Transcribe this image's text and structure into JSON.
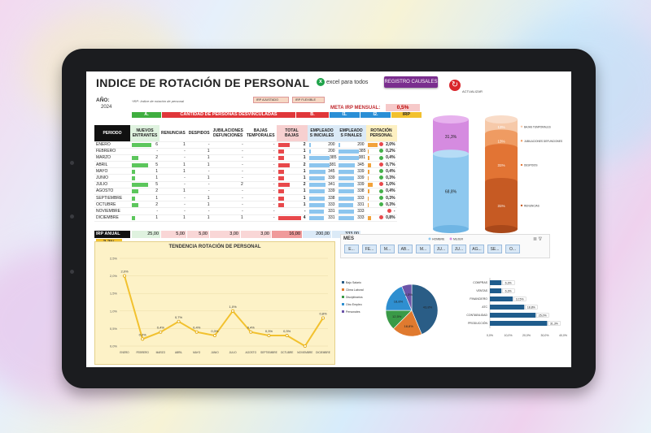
{
  "title": "INDICE DE ROTACIÓN DE PERSONAL",
  "logo": "excel para todos",
  "register_button": "REGISTRO CAUSALES",
  "update_label": "ACTUALIZAR",
  "year_label": "AÑO:",
  "year": "2024",
  "irp_note": "*IRP: Indice de rotación de personal",
  "option_adjusted": "IRP AJUSTADO",
  "option_flexible": "IRP FLEXIBLE",
  "meta_label": "META IRP MENSUAL:",
  "meta_value": "0,5%",
  "group_a": "A.",
  "group_desv": "CANTIDAD DE PERSONAS DESVINCULADAS",
  "group_b": "B.",
  "group_i1": "I1.",
  "group_i2": "I2.",
  "group_irp": "IRP",
  "columns": [
    "PERIODO",
    "NUEVOS ENTRANTES",
    "RENUNCIAS",
    "DESPIDOS",
    "JUBILACIONES DEFUNCIONES",
    "BAJAS TEMPORALES",
    "TOTAL BAJAS",
    "EMPLEADO S INICIALES",
    "EMPLEADO S FINALES",
    "ROTACIÓN PERSONAL"
  ],
  "rows": [
    {
      "m": "ENERO",
      "n": "6",
      "r": "1",
      "d": "-",
      "j": "-",
      "b": "-",
      "t": "2",
      "i": "200",
      "f": "200",
      "p": "2,0%"
    },
    {
      "m": "FEBRERO",
      "n": "-",
      "r": "-",
      "d": "1",
      "j": "-",
      "b": "-",
      "t": "1",
      "i": "200",
      "f": "385",
      "p": "0,2%"
    },
    {
      "m": "MARZO",
      "n": "2",
      "r": "-",
      "d": "1",
      "j": "-",
      "b": "-",
      "t": "1",
      "i": "385",
      "f": "381",
      "p": "0,4%"
    },
    {
      "m": "ABRIL",
      "n": "5",
      "r": "1",
      "d": "1",
      "j": "-",
      "b": "-",
      "t": "2",
      "i": "381",
      "f": "345",
      "p": "0,7%"
    },
    {
      "m": "MAYO",
      "n": "1",
      "r": "1",
      "d": "-",
      "j": "-",
      "b": "-",
      "t": "1",
      "i": "345",
      "f": "339",
      "p": "0,4%"
    },
    {
      "m": "JUNIO",
      "n": "1",
      "r": "-",
      "d": "1",
      "j": "-",
      "b": "-",
      "t": "1",
      "i": "339",
      "f": "339",
      "p": "0,3%"
    },
    {
      "m": "JULIO",
      "n": "5",
      "r": "-",
      "d": "-",
      "j": "2",
      "b": "-",
      "t": "2",
      "i": "341",
      "f": "339",
      "p": "1,0%"
    },
    {
      "m": "AGOSTO",
      "n": "2",
      "r": "1",
      "d": "-",
      "j": "-",
      "b": "-",
      "t": "1",
      "i": "339",
      "f": "338",
      "p": "0,4%"
    },
    {
      "m": "SEPTIEMBRE",
      "n": "1",
      "r": "-",
      "d": "1",
      "j": "-",
      "b": "-",
      "t": "1",
      "i": "338",
      "f": "333",
      "p": "0,3%"
    },
    {
      "m": "OCTUBRE",
      "n": "2",
      "r": "-",
      "d": "1",
      "j": "-",
      "b": "-",
      "t": "1",
      "i": "333",
      "f": "331",
      "p": "0,3%"
    },
    {
      "m": "NOVIEMBRE",
      "n": "-",
      "r": "-",
      "d": "-",
      "j": "-",
      "b": "-",
      "t": "-",
      "i": "331",
      "f": "333",
      "p": "-"
    },
    {
      "m": "DICIEMBRE",
      "n": "1",
      "r": "1",
      "d": "1",
      "j": "1",
      "b": "-",
      "t": "4",
      "i": "331",
      "f": "333",
      "p": "0,8%"
    }
  ],
  "irp_annual_label": "IRP ANUAL",
  "totals": {
    "n": "25,00",
    "r": "5,00",
    "d": "5,00",
    "j": "3,00",
    "b": "3,00",
    "t": "16,00",
    "i": "200,00",
    "f": "333,00"
  },
  "irp_annual_value": "7,7%",
  "trend_title": "TENDENCIA ROTACIÓN DE PERSONAL",
  "mes_label": "MES",
  "mes_chips": [
    "E...",
    "FE...",
    "M...",
    "AB...",
    "M...",
    "JU...",
    "JU...",
    "AG...",
    "SE...",
    "O..."
  ],
  "cyl_left": {
    "top": "31,3%",
    "bottom": "68,8%"
  },
  "cyl_right": [
    "13%",
    "13%",
    "31%",
    "31%"
  ],
  "cyl_right_labels": [
    "BAJAS TEMPORALES",
    "JUBILACIONES DEFUNCIONES",
    "DESPIDOS",
    "RENUNCIAS"
  ],
  "legend_gender": [
    "HOMBRE",
    "MUJER"
  ],
  "pie_legend": [
    "Bajo Salario",
    "Clima Laboral",
    "Disciplinarios",
    "Otro Empleo",
    "Personales"
  ],
  "pie_labels": [
    "43,8%",
    "18,8%",
    "12,5%",
    "18,8%",
    "6,3%"
  ],
  "hbar": {
    "cats": [
      "COMPRAS",
      "VENTAS",
      "FINANCIERO",
      "ATC",
      "CONTABILIDAD",
      "PRODUCCIÓN"
    ],
    "vals": [
      6.3,
      6.3,
      12.5,
      18.8,
      25.0,
      31.3
    ],
    "labels": [
      "6,3%",
      "6,3%",
      "12,5%",
      "18,8%",
      "25,0%",
      "31,3%"
    ],
    "ticks": [
      "0,0%",
      "10,0%",
      "20,0%",
      "30,0%",
      "40,0%"
    ]
  },
  "chart_data": {
    "type": "line",
    "title": "TENDENCIA ROTACIÓN DE PERSONAL",
    "categories": [
      "ENERO",
      "FEBRERO",
      "MARZO",
      "ABRIL",
      "MAYO",
      "JUNIO",
      "JULIO",
      "AGOSTO",
      "SEPTIEMBRE",
      "OCTUBRE",
      "NOVIEMBRE",
      "DICIEMBRE"
    ],
    "values": [
      2.0,
      0.2,
      0.4,
      0.7,
      0.4,
      0.3,
      1.0,
      0.4,
      0.3,
      0.3,
      0.0,
      0.8
    ],
    "labels": [
      "2,0%",
      "0,2%",
      "0,4%",
      "0,7%",
      "0,4%",
      "0,3%",
      "1,0%",
      "0,4%",
      "0,3%",
      "0,3%",
      "",
      "0,8%"
    ],
    "ylim": [
      0,
      2.5
    ],
    "yticks": [
      "0,0%",
      "0,5%",
      "1,0%",
      "1,5%",
      "2,0%",
      "2,5%"
    ]
  }
}
